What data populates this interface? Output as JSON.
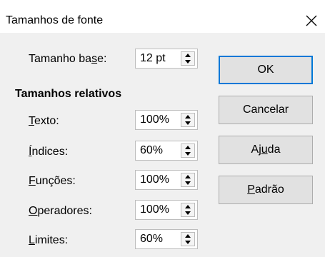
{
  "window": {
    "title": "Tamanhos de fonte"
  },
  "base_size": {
    "label_pre": "Tamanho ba",
    "label_mnemonic": "s",
    "label_post": "e:",
    "value": "12 pt"
  },
  "relative": {
    "heading": "Tamanhos relativos",
    "items": [
      {
        "label_pre": "",
        "label_mnemonic": "T",
        "label_post": "exto:",
        "value": "100%"
      },
      {
        "label_pre": "",
        "label_mnemonic": "Í",
        "label_post": "ndices:",
        "value": "60%"
      },
      {
        "label_pre": "",
        "label_mnemonic": "F",
        "label_post": "unções:",
        "value": "100%"
      },
      {
        "label_pre": "",
        "label_mnemonic": "O",
        "label_post": "peradores:",
        "value": "100%"
      },
      {
        "label_pre": "",
        "label_mnemonic": "L",
        "label_post": "imites:",
        "value": "60%"
      }
    ]
  },
  "buttons": {
    "ok": "OK",
    "cancel": "Cancelar",
    "help_pre": "Aj",
    "help_mnemonic": "u",
    "help_post": "da",
    "default_pre": "",
    "default_mnemonic": "P",
    "default_post": "adrão"
  },
  "icons": {
    "close": "close-icon",
    "spin_up": "spin-up-icon",
    "spin_down": "spin-down-icon"
  }
}
